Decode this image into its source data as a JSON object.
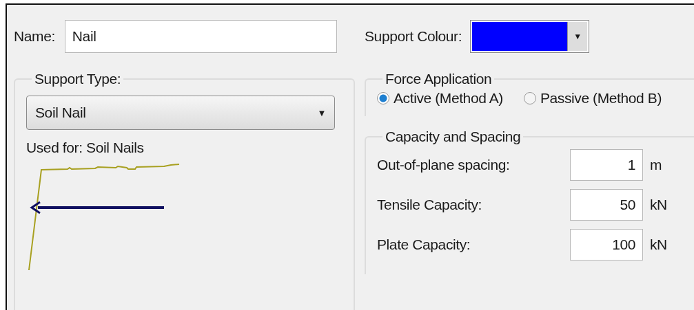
{
  "name": {
    "label": "Name:",
    "value": "Nail"
  },
  "support_colour": {
    "label": "Support Colour:",
    "color": "#0000ff",
    "dropdown_arrow": "▼"
  },
  "support_type": {
    "title": "Support Type:",
    "selected_value": "Soil Nail",
    "dropdown_arrow": "▼",
    "used_for": "Used for: Soil Nails"
  },
  "force_application": {
    "title": "Force Application",
    "options": [
      {
        "label": "Active (Method A)",
        "selected": true
      },
      {
        "label": "Passive (Method B)",
        "selected": false
      }
    ]
  },
  "capacity_and_spacing": {
    "title": "Capacity and Spacing",
    "rows": [
      {
        "label": "Out-of-plane spacing:",
        "value": "1",
        "unit": "m"
      },
      {
        "label": "Tensile Capacity:",
        "value": "50",
        "unit": "kN"
      },
      {
        "label": "Plate Capacity:",
        "value": "100",
        "unit": "kN"
      }
    ]
  }
}
